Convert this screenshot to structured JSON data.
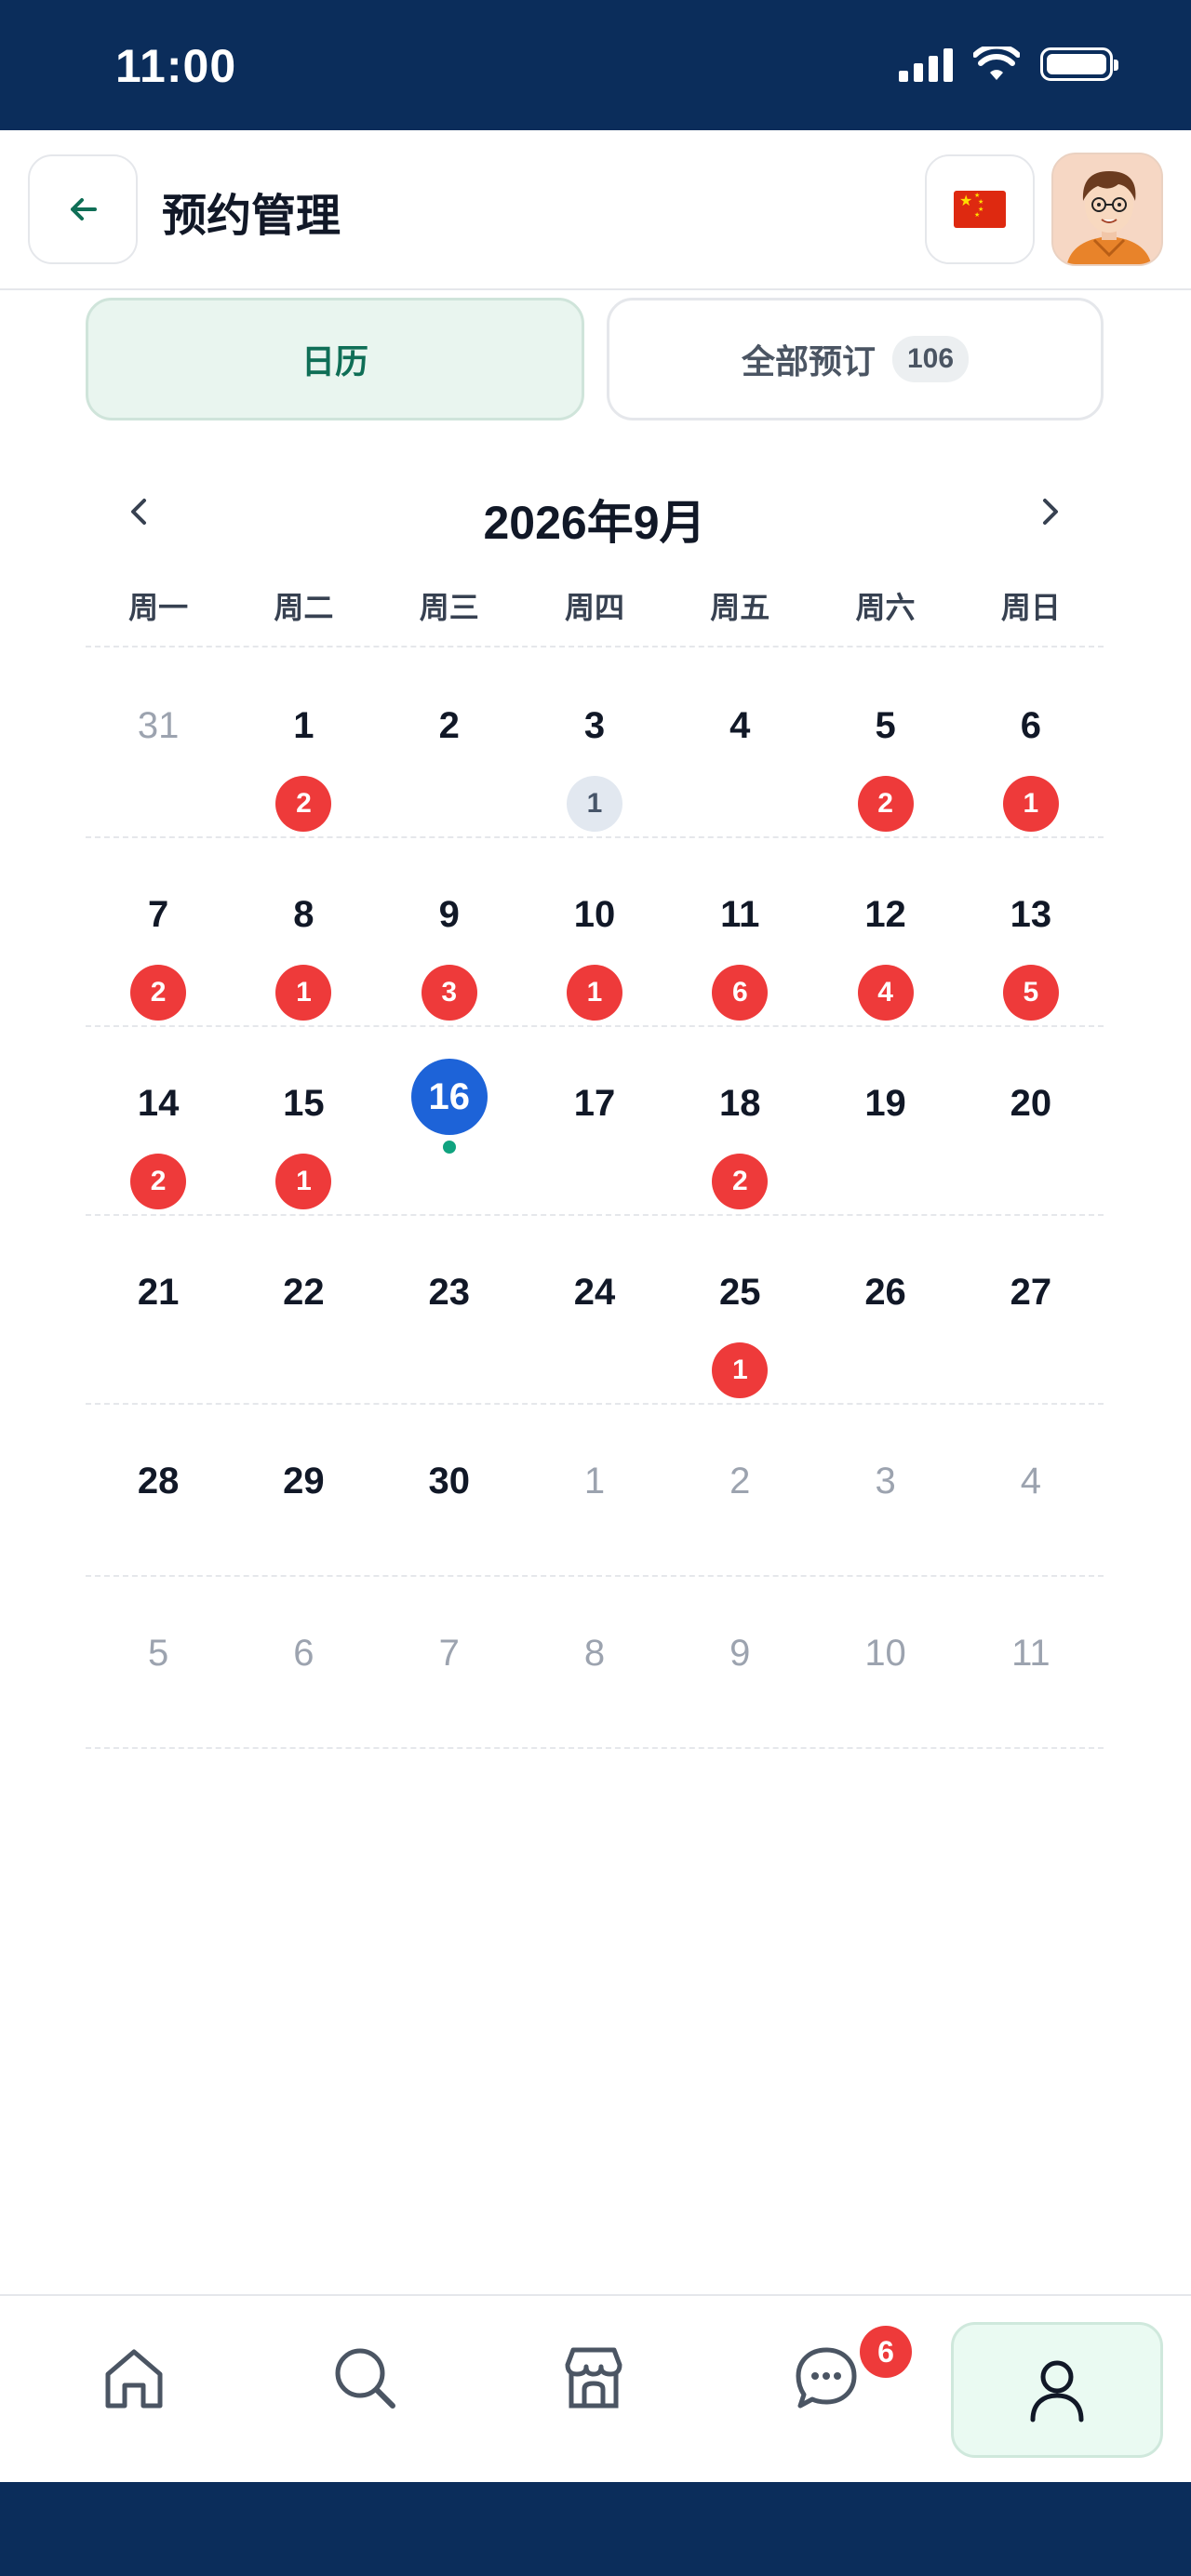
{
  "status_bar": {
    "time": "11:00"
  },
  "header": {
    "title": "预约管理"
  },
  "tabs": {
    "calendar_label": "日历",
    "all_label": "全部预订",
    "all_count": "106"
  },
  "calendar": {
    "month_title": "2026年9月",
    "weekdays": [
      "周一",
      "周二",
      "周三",
      "周四",
      "周五",
      "周六",
      "周日"
    ],
    "weeks": [
      [
        {
          "day": "31",
          "muted": true
        },
        {
          "day": "1",
          "badge": "2"
        },
        {
          "day": "2"
        },
        {
          "day": "3",
          "badge": "1",
          "badge_style": "grey"
        },
        {
          "day": "4"
        },
        {
          "day": "5",
          "badge": "2"
        },
        {
          "day": "6",
          "badge": "1"
        }
      ],
      [
        {
          "day": "7",
          "badge": "2"
        },
        {
          "day": "8",
          "badge": "1"
        },
        {
          "day": "9",
          "badge": "3"
        },
        {
          "day": "10",
          "badge": "1"
        },
        {
          "day": "11",
          "badge": "6"
        },
        {
          "day": "12",
          "badge": "4"
        },
        {
          "day": "13",
          "badge": "5"
        }
      ],
      [
        {
          "day": "14",
          "badge": "2"
        },
        {
          "day": "15",
          "badge": "1"
        },
        {
          "day": "16",
          "today": true
        },
        {
          "day": "17"
        },
        {
          "day": "18",
          "badge": "2"
        },
        {
          "day": "19"
        },
        {
          "day": "20"
        }
      ],
      [
        {
          "day": "21"
        },
        {
          "day": "22"
        },
        {
          "day": "23"
        },
        {
          "day": "24"
        },
        {
          "day": "25",
          "badge": "1"
        },
        {
          "day": "26"
        },
        {
          "day": "27"
        }
      ],
      [
        {
          "day": "28"
        },
        {
          "day": "29"
        },
        {
          "day": "30"
        },
        {
          "day": "1",
          "muted": true
        },
        {
          "day": "2",
          "muted": true
        },
        {
          "day": "3",
          "muted": true
        },
        {
          "day": "4",
          "muted": true
        }
      ],
      [
        {
          "day": "5",
          "muted": true
        },
        {
          "day": "6",
          "muted": true
        },
        {
          "day": "7",
          "muted": true
        },
        {
          "day": "8",
          "muted": true
        },
        {
          "day": "9",
          "muted": true
        },
        {
          "day": "10",
          "muted": true
        },
        {
          "day": "11",
          "muted": true
        }
      ]
    ]
  },
  "bottom_nav": {
    "items": [
      "home-icon",
      "search-icon",
      "store-icon",
      "chat-icon",
      "profile-icon"
    ],
    "chat_badge": "6",
    "active": "profile"
  },
  "colors": {
    "status_bar_bg": "#0b2d5b",
    "accent_green": "#0f6e56",
    "today_blue": "#1d63d8",
    "badge_red": "#ee3a3a"
  }
}
